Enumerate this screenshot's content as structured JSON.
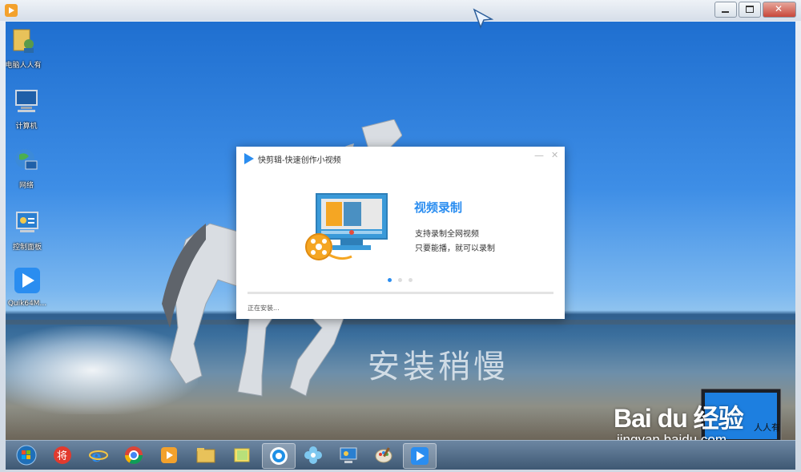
{
  "desktop_icons": [
    {
      "label": "电脑人人有",
      "icon": "folder-user-icon"
    },
    {
      "label": "计算机",
      "icon": "computer-icon"
    },
    {
      "label": "网络",
      "icon": "network-globe-icon"
    },
    {
      "label": "控制面板",
      "icon": "control-panel-icon"
    },
    {
      "label": "Quik64M...",
      "icon": "kuaijianji-app-icon"
    }
  ],
  "dialog": {
    "title": "快剪辑-快速创作小视频",
    "feature_title": "视频录制",
    "feature_line1": "支持录制全网视频",
    "feature_line2": "只要能播，就可以录制",
    "status": "正在安装...",
    "progress": 0.0,
    "carousel_active_index": 0,
    "carousel_count": 3
  },
  "overlay_text": "安装稍慢",
  "watermark": {
    "logo": "Bai du 经验",
    "url": "jingyan.baidu.com",
    "laptop_text": "人人有"
  },
  "taskbar_items": [
    "start-orb-icon",
    "jiang-app-icon",
    "ie-browser-icon",
    "chrome-icon",
    "media-player-icon",
    "file-explorer-icon",
    "sticky-notes-icon",
    "qq-browser-icon",
    "flower-app-icon",
    "remote-desktop-icon",
    "paint-icon",
    "kuaijianji-app-icon"
  ],
  "colors": {
    "accent": "#2a8df0",
    "sky": "#3e8ee6"
  }
}
